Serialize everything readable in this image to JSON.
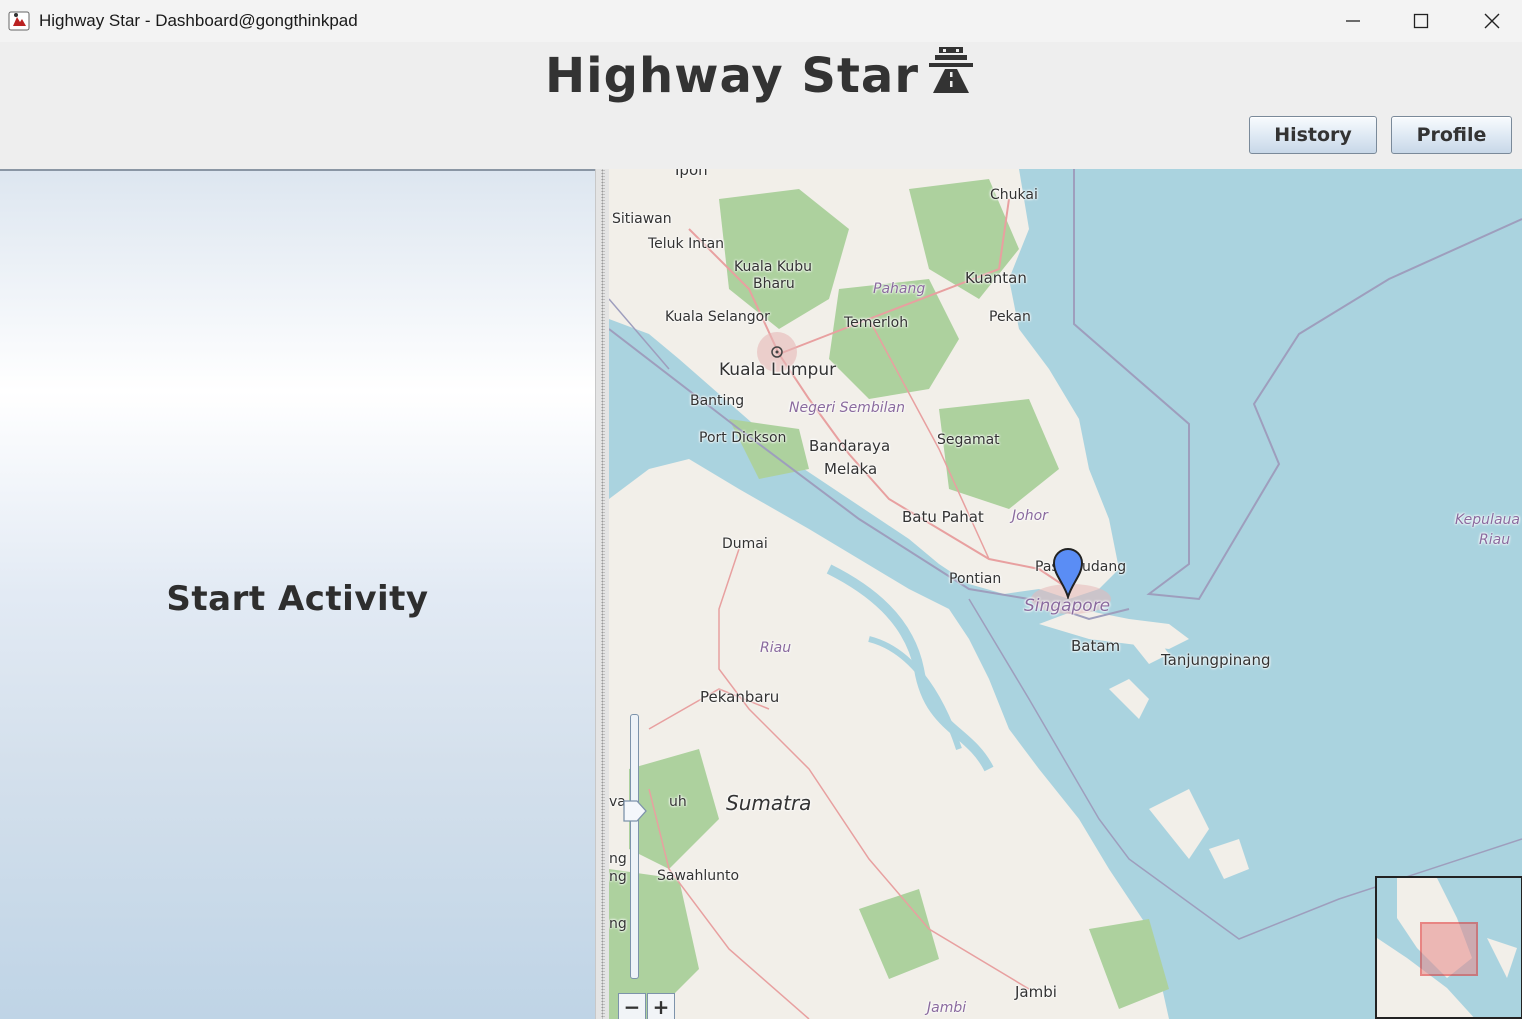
{
  "window": {
    "title": "Highway Star - Dashboard@gongthinkpad",
    "controls": [
      "minimize",
      "maximize",
      "close"
    ]
  },
  "header": {
    "title": "Highway Star",
    "title_icon": "road-icon",
    "buttons": {
      "history": "History",
      "profile": "Profile"
    }
  },
  "left_panel": {
    "start_label": "Start Activity"
  },
  "map": {
    "labels": {
      "ipoh": "Ipoh",
      "chukai": "Chukai",
      "sitiawan": "Sitiawan",
      "teluk_intan": "Teluk Intan",
      "kuala_kubu_bharu_1": "Kuala Kubu",
      "kuala_kubu_bharu_2": "Bharu",
      "pahang": "Pahang",
      "kuantan": "Kuantan",
      "kuala_selangor": "Kuala Selangor",
      "temerloh": "Temerloh",
      "pekan": "Pekan",
      "kuala_lumpur": "Kuala Lumpur",
      "banting": "Banting",
      "negeri_sembilan": "Negeri Sembilan",
      "port_dickson": "Port Dickson",
      "bandaraya": "Bandaraya",
      "segamat": "Segamat",
      "melaka": "Melaka",
      "batu_pahat": "Batu Pahat",
      "johor": "Johor",
      "kepulauan_1": "Kepulaua",
      "kepulauan_2": "Riau",
      "dumai": "Dumai",
      "pontian": "Pontian",
      "pasir_gudang_1": "Pas",
      "pasir_gudang_2": "udang",
      "singapore": "Singapore",
      "batam": "Batam",
      "tanjungpinang": "Tanjungpinang",
      "riau": "Riau",
      "pekanbaru": "Pekanbaru",
      "sumatra": "Sumatra",
      "tanjung_buh": "uh",
      "sawahlunto": "Sawahlunto",
      "jambi": "Jambi",
      "jambi_region": "Jambi",
      "edge_1": "ng",
      "edge_2": "ng",
      "edge_3": "ng",
      "edge_4": "va"
    },
    "zoom": {
      "minus": "−",
      "plus": "+"
    },
    "marker": "location-marker-icon"
  },
  "colors": {
    "water": "#aad3df",
    "land": "#f2efe9",
    "forest": "#add19e",
    "border": "#9e9ebd",
    "road": "#e8a0a0",
    "marker": "#5a8df5",
    "minimap_box": "#e03030"
  }
}
